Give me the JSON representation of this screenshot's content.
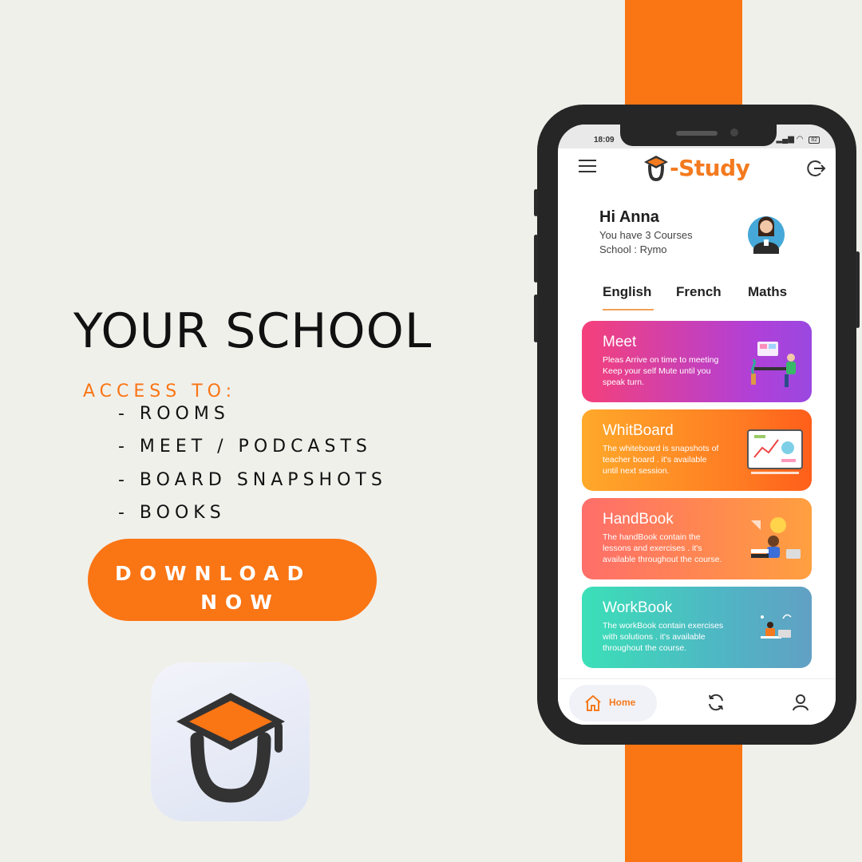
{
  "headline": "YOUR SCHOOL",
  "access_label": "ACCESS TO:",
  "features": [
    "- ROOMS",
    "- MEET / PODCASTS",
    "- BOARD SNAPSHOTS",
    "- BOOKS"
  ],
  "download": {
    "line1": "DOWNLOAD",
    "line2": "NOW"
  },
  "colors": {
    "accent": "#fa7514",
    "background": "#f0f0eb"
  },
  "phone": {
    "status": {
      "time": "18:09",
      "battery": "82"
    },
    "app_name": "-Study",
    "greeting": "Hi Anna",
    "courses_text": "You have 3 Courses",
    "school_text": "School  : Rymo",
    "tabs": [
      "English",
      "French",
      "Maths"
    ],
    "active_tab": "English",
    "cards": [
      {
        "title": "Meet",
        "desc": "Pleas Arrive on time to meeting\nKeep your self Mute until you\nspeak turn.",
        "icon": "meeting-illustration-icon"
      },
      {
        "title": "WhitBoard",
        "desc": "The whiteboard is snapshots of\nteacher board . it's available\nuntil next session.",
        "icon": "whiteboard-illustration-icon"
      },
      {
        "title": "HandBook",
        "desc": "The handBook contain the\nlessons and exercises . it's\navailable throughout the course.",
        "icon": "handbook-illustration-icon"
      },
      {
        "title": "WorkBook",
        "desc": "The workBook contain exercises\nwith solutions .  it's available\nthroughout the course.",
        "icon": "workbook-illustration-icon"
      }
    ],
    "nav": {
      "home": "Home"
    }
  }
}
